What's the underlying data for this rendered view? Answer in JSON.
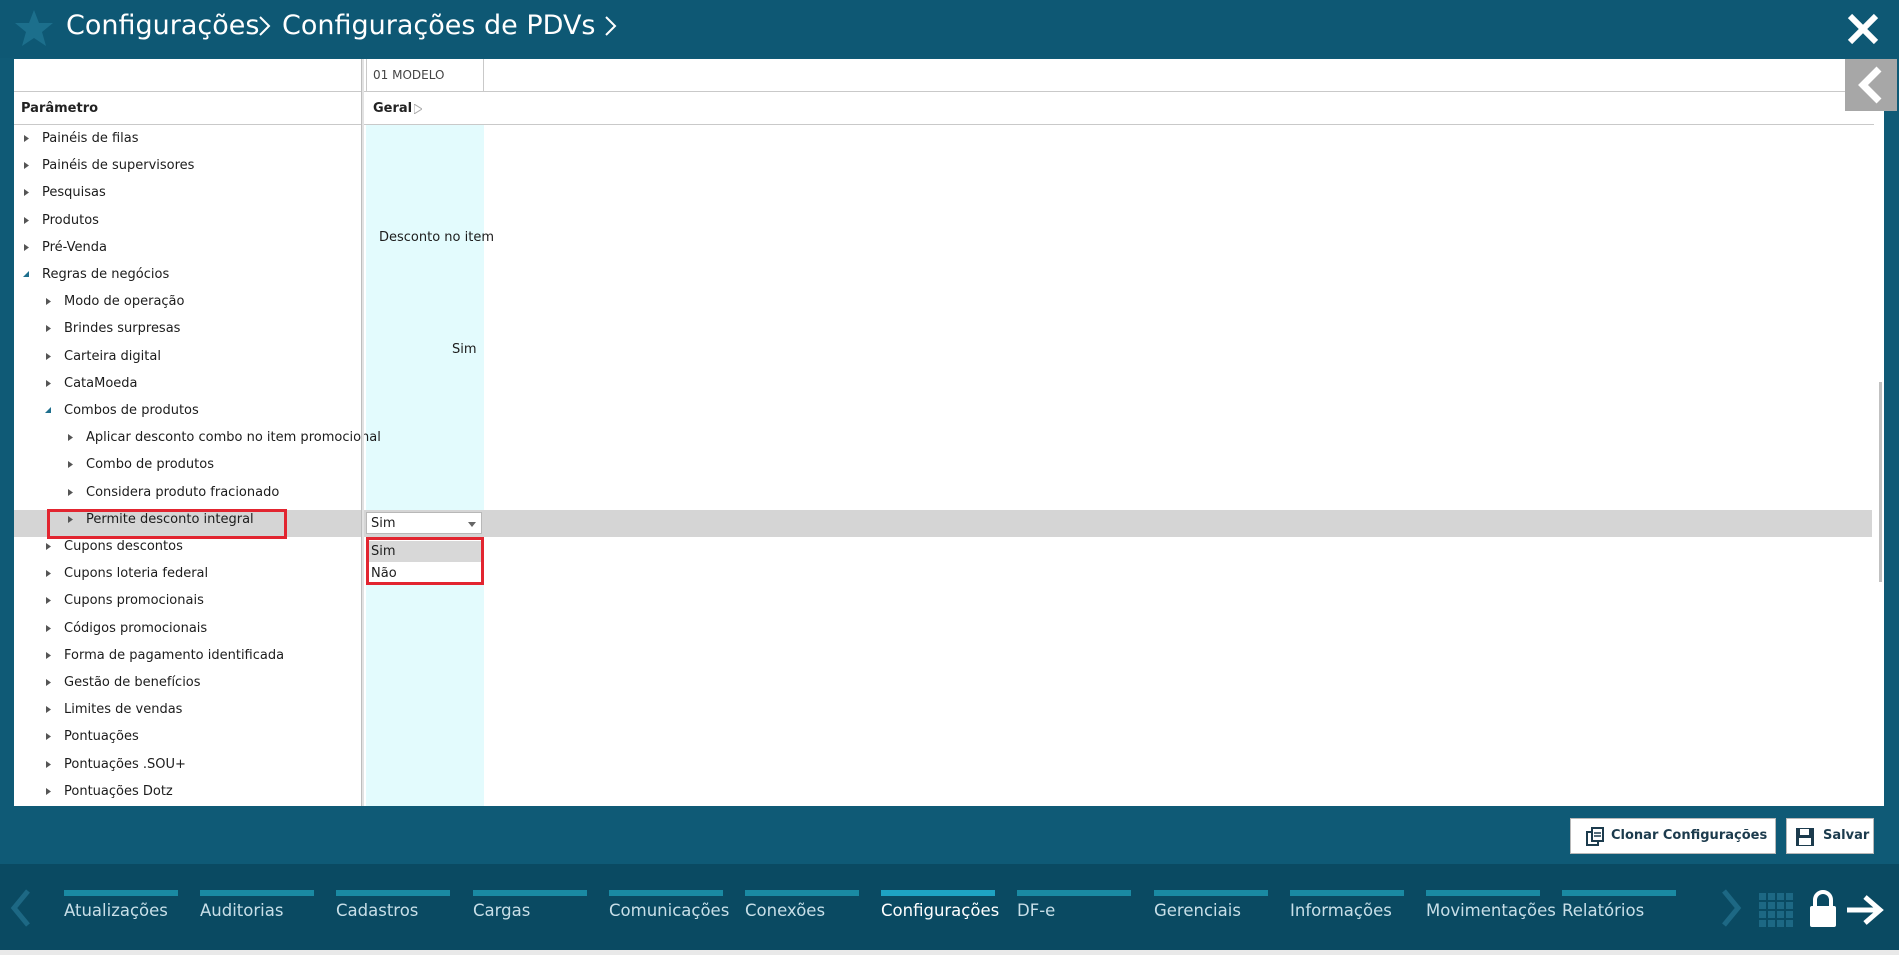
{
  "header": {
    "crumb_1": "Configurações",
    "crumb_2": "Configurações de PDVs"
  },
  "grid": {
    "column_model": "01 MODELO",
    "param_header": "Parâmetro",
    "group_header": "Geral",
    "desconto_label": "Desconto no item",
    "aplicar_value": "Sim"
  },
  "tree": [
    {
      "label": "Painéis de filas",
      "level": 0,
      "expanded": false
    },
    {
      "label": "Painéis de supervisores",
      "level": 0,
      "expanded": false
    },
    {
      "label": "Pesquisas",
      "level": 0,
      "expanded": false
    },
    {
      "label": "Produtos",
      "level": 0,
      "expanded": false
    },
    {
      "label": "Pré-Venda",
      "level": 0,
      "expanded": false
    },
    {
      "label": "Regras de negócios",
      "level": 0,
      "expanded": true
    },
    {
      "label": "Modo de operação",
      "level": 1,
      "expanded": false
    },
    {
      "label": "Brindes surpresas",
      "level": 1,
      "expanded": false
    },
    {
      "label": "Carteira digital",
      "level": 1,
      "expanded": false
    },
    {
      "label": "CataMoeda",
      "level": 1,
      "expanded": false
    },
    {
      "label": "Combos de produtos",
      "level": 1,
      "expanded": true
    },
    {
      "label": "Aplicar desconto combo no item promocional",
      "level": 2,
      "expanded": false
    },
    {
      "label": "Combo de produtos",
      "level": 2,
      "expanded": false
    },
    {
      "label": "Considera produto fracionado",
      "level": 2,
      "expanded": false
    },
    {
      "label": "Permite desconto integral",
      "level": 2,
      "expanded": false
    },
    {
      "label": "Cupons descontos",
      "level": 1,
      "expanded": false
    },
    {
      "label": "Cupons loteria federal",
      "level": 1,
      "expanded": false
    },
    {
      "label": "Cupons promocionais",
      "level": 1,
      "expanded": false
    },
    {
      "label": "Códigos promocionais",
      "level": 1,
      "expanded": false
    },
    {
      "label": "Forma de pagamento identificada",
      "level": 1,
      "expanded": false
    },
    {
      "label": "Gestão de benefícios",
      "level": 1,
      "expanded": false
    },
    {
      "label": "Limites de vendas",
      "level": 1,
      "expanded": false
    },
    {
      "label": "Pontuações",
      "level": 1,
      "expanded": false
    },
    {
      "label": "Pontuações .SOU+",
      "level": 1,
      "expanded": false
    },
    {
      "label": "Pontuações Dotz",
      "level": 1,
      "expanded": false
    }
  ],
  "dropdown": {
    "selected": "Sim",
    "options": [
      "Sim",
      "Não"
    ]
  },
  "actions": {
    "clone_label": "Clonar Configurações",
    "save_label": "Salvar"
  },
  "nav": {
    "tabs": [
      {
        "label": "Atualizações",
        "active": false
      },
      {
        "label": "Auditorias",
        "active": false
      },
      {
        "label": "Cadastros",
        "active": false
      },
      {
        "label": "Cargas",
        "active": false
      },
      {
        "label": "Comunicações",
        "active": false
      },
      {
        "label": "Conexões",
        "active": false
      },
      {
        "label": "Configurações",
        "active": true
      },
      {
        "label": "DF-e",
        "active": false
      },
      {
        "label": "Gerenciais",
        "active": false
      },
      {
        "label": "Informações",
        "active": false
      },
      {
        "label": "Movimentações",
        "active": false
      },
      {
        "label": "Relatórios",
        "active": false
      }
    ]
  },
  "icons": {
    "star": "star-icon",
    "close": "close-icon",
    "collapse": "chevron-left-icon",
    "clone": "copy-icon",
    "save": "floppy-disk-icon",
    "grid": "grid-icon",
    "lock": "lock-icon",
    "logout": "arrow-right-icon"
  },
  "colors": {
    "header_bg": "#0e5874",
    "nav_bg": "#0a4a62",
    "value_column_bg": "#e3fbfd",
    "highlight_red": "#e22530",
    "selected_row_bg": "#d5d5d5"
  }
}
